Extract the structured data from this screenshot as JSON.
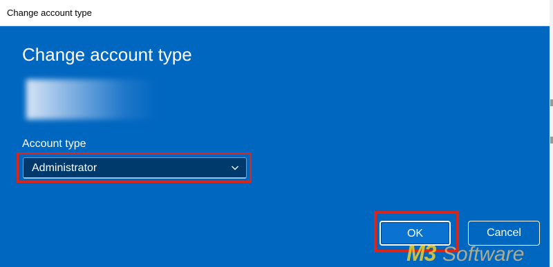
{
  "window": {
    "title": "Change account type"
  },
  "dialog": {
    "heading": "Change account type",
    "field_label": "Account type",
    "dropdown": {
      "selected": "Administrator",
      "icon": "chevron-down-icon"
    },
    "buttons": {
      "ok_label": "OK",
      "cancel_label": "Cancel"
    }
  },
  "watermark": {
    "brand_prefix": "M3",
    "brand_suffix": "Software"
  },
  "colors": {
    "dialog_background": "#0067c0",
    "dropdown_background": "#00396b",
    "highlight": "#d9261c",
    "watermark": "#f8d228"
  }
}
